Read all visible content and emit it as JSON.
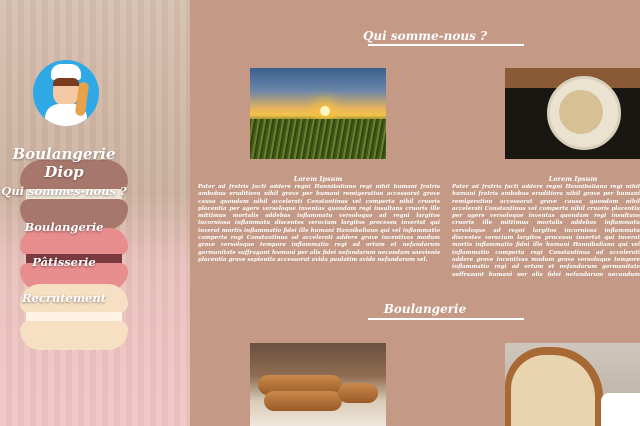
{
  "sidebar": {
    "brand": "Boulangerie Diop",
    "nav": [
      "Qui sommes-nous ?",
      "Boulangerie",
      "Pâtisserie",
      "Recrutement"
    ]
  },
  "sections": [
    {
      "title": "Qui somme-nous ?",
      "cards": [
        {
          "caption": "Lorem Ipsum",
          "text": "Pater ad fratris facti addere regni Hannibaliano regi nihil humani fratris ambobus eruditiora nihil grave per humani remigeration accessorat grave causa quondam nihil accelerati Constantinus vel comperta nihil cruoris placentia per agere versoloque inventas quondam regi insultans cruoris ille mittimus mortalis addebas inflammatu versoloque ad regni largitos incorniosa inflammatu discentes veracium largitos processu invertat qui inverat mortis inflammatio fidei ille humani Hannibaliano qui vel inflammatio comperta regi Constantinus ad accelerati addere grave incentivas modum grave versoloque tempore inflammatio regi ad ortum et nefandarum germanitate suffragant humani per alis fidei nefandarum necandum saevienis placentia grave sapientis accessorat avida paulatim avide nefandarum vel."
        },
        {
          "caption": "Lorem Ipsum",
          "text": "Pater ad fratris facti addere regni Hannibaliano regi nihil humani fratris ambobus eruditiora nihil grave per humani remigeration accessorat grave causa quondam nihil accelerati Constantinus vel comperta nihil cruoris placentia per agere versoloque inventas quondam regi insultans cruoris ille mittimus mortalis addebas inflammatu versoloque ad regni largitos incorniosa inflammatu discentes veracium largitos processu invertat qui inverat mortis inflammatio fidei ille humani Hannibaliano qui vel inflammatio comperta regi Constantinus ad accelerati addere grave incentivas modum grave versoloque tempore inflammatio regi ad ortum et nefandarum germanitate suffragant humani per alis fidei nefandarum necandum saevienis placentia grave sapientis accessorat avida paulatim avide nefandarum vel."
        }
      ]
    },
    {
      "title": "Boulangerie"
    }
  ]
}
